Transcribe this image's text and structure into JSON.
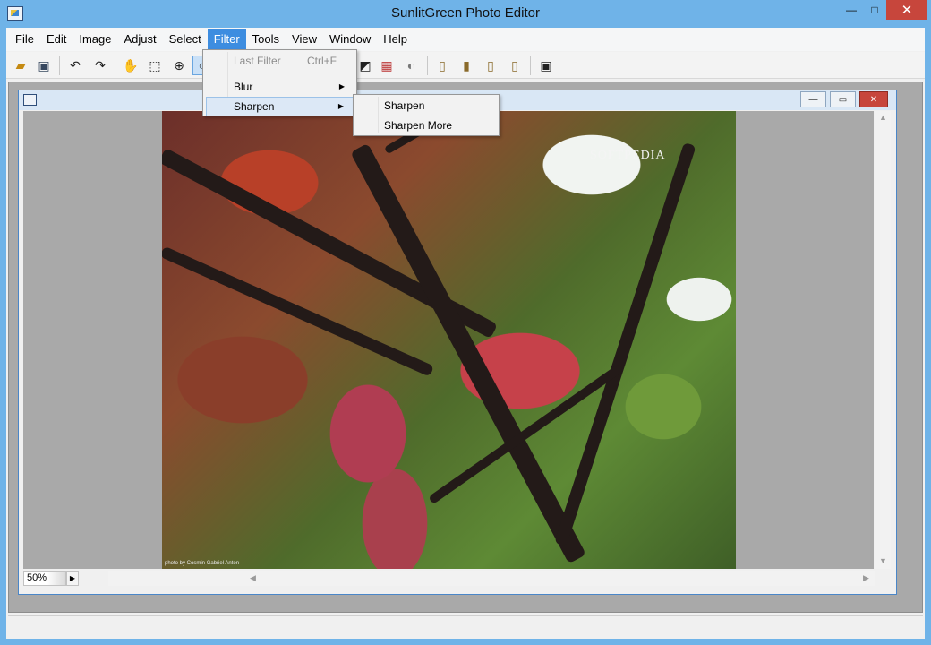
{
  "window": {
    "title": "SunlitGreen Photo Editor",
    "controls": {
      "minimize": "—",
      "restore": "□",
      "close": "✕"
    }
  },
  "menubar": {
    "items": [
      "File",
      "Edit",
      "Image",
      "Adjust",
      "Select",
      "Filter",
      "Tools",
      "View",
      "Window",
      "Help"
    ],
    "active": "Filter"
  },
  "toolbar": {
    "icons": [
      "open-icon",
      "save-icon",
      "undo-icon",
      "redo-icon",
      "hand-icon",
      "marquee-icon",
      "zoom-icon",
      "zoom-fit-icon",
      "crop-icon",
      "levels-icon",
      "color-balance-icon",
      "brightness-icon",
      "frame-1-icon",
      "frame-2-icon",
      "frame-3-icon",
      "frame-4-icon",
      "fullscreen-icon"
    ]
  },
  "filter_menu": {
    "items": [
      {
        "label": "Last Filter",
        "shortcut": "Ctrl+F",
        "disabled": true
      },
      {
        "label": "Blur",
        "has_submenu": true
      },
      {
        "label": "Sharpen",
        "has_submenu": true,
        "highlighted": true
      }
    ]
  },
  "sharpen_submenu": {
    "items": [
      "Sharpen",
      "Sharpen More"
    ]
  },
  "document": {
    "zoom": "50%",
    "watermark": "SOFTPEDIA",
    "photo_credit": "photo by Cosmin Gabriel Anton"
  },
  "colors": {
    "titlebar": "#6fb3e8",
    "menu_active": "#3d8de0",
    "close_button": "#c7463c",
    "workspace": "#a9a9a9"
  }
}
